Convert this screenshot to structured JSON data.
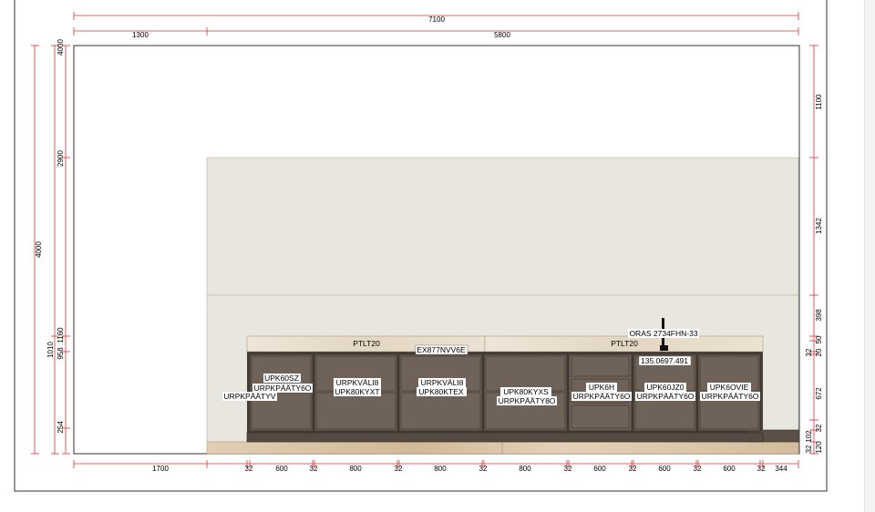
{
  "dimensions": {
    "top_total": "7100",
    "top_left": "1300",
    "top_right": "5800",
    "left_outer": "4000",
    "left_outer_top": "4000",
    "left_outer_mid": "1010",
    "left_inner_top": "2900",
    "left_inner_a": "1160",
    "left_inner_b": "958",
    "left_inner_c": "254",
    "right_1": "1100",
    "right_2": "1342",
    "right_3": "398",
    "right_4": "50",
    "right_5": "32",
    "right_6": "20",
    "right_7": "672",
    "right_8": "32",
    "right_9": "102",
    "right_10": "120",
    "right_11": "32",
    "bottom": [
      "1700",
      "32",
      "600",
      "32",
      "800",
      "32",
      "800",
      "32",
      "800",
      "32",
      "600",
      "32",
      "600",
      "32",
      "600",
      "32",
      "344"
    ]
  },
  "labels": {
    "worktop_left": "PTLT20",
    "worktop_right": "PTLT20",
    "hob": "EX877NVV6E",
    "tap": "ORAS 2734FHN-33",
    "tap_value": "135.0697.491",
    "cab1_side": "URPKPÄÄTYV",
    "cab2_line1": "UPK60SZ",
    "cab2_line2": "URPKPÄÄTY6O",
    "cab3_line1": "URPKVÄLI8",
    "cab3_line2": "UPK80KYXT",
    "cab4_line1": "URPKVÄLI8",
    "cab4_line2": "UPK80KTEX",
    "cab5_line1": "UPK80KYXS",
    "cab5_line2": "URPKPÄÄTY8O",
    "cab6_line1": "UPK6H",
    "cab6_line2": "URPKPÄÄTY6O",
    "cab7_line1": "UPK60JZ0",
    "cab7_line2": "URPKPÄÄTY6O",
    "cab8_line1": "UPK6OVIE",
    "cab8_line2": "URPKPÄÄTY6O"
  },
  "colors": {
    "dimension": "#e03030",
    "wall": "#e8e5de",
    "cabinet": "#6e6258",
    "cabinet_dark": "#3f3731",
    "worktop": "#e7dccb",
    "floor": "#d9c4a6"
  }
}
